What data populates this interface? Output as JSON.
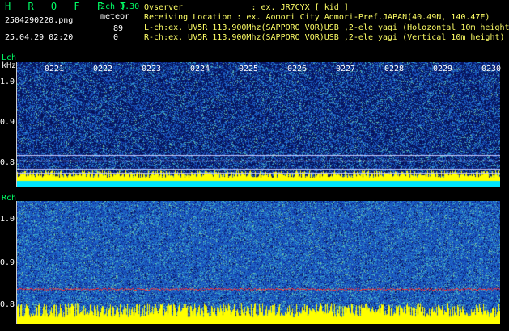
{
  "header": {
    "app_title": "H R O F F T",
    "version": "2ch 0.30",
    "filename": "2504290220.png",
    "mode": "meteor",
    "count_l": "89",
    "count_r": "0",
    "datetime": "25.04.29 02:20",
    "observer": "Ovserver              : ex. JR7CYX [ kid ]",
    "location": "Receiving Location : ex. Aomori City Aomori-Pref.JAPAN(40.49N, 140.47E)",
    "lch_info": "L-ch:ex. UV5R 113.900Mhz(SAPPORO VOR)USB ,2-ele yagi (Holozontal 10m height)",
    "rch_info": "R-ch:ex. UV5R 113.900Mhz(SAPPORO VOR)USB ,2-ele yagi (Vertical 10m height)"
  },
  "lch": {
    "label": "Lch",
    "unit": "kHz",
    "ticks": [
      "1.0",
      "0.9",
      "0.8"
    ]
  },
  "rch": {
    "label": "Rch",
    "ticks": [
      "1.0",
      "0.9",
      "0.8"
    ]
  },
  "time_labels": [
    "0221",
    "0222",
    "0223",
    "0224",
    "0225",
    "0226",
    "0227",
    "0228",
    "0229",
    "0230"
  ],
  "colors": {
    "noise_bg": "#06125a",
    "noise_hi": "#1e90ff",
    "signal": "#ffff00",
    "cyan_band": "#00e5ff",
    "red_line": "#ff3030"
  }
}
